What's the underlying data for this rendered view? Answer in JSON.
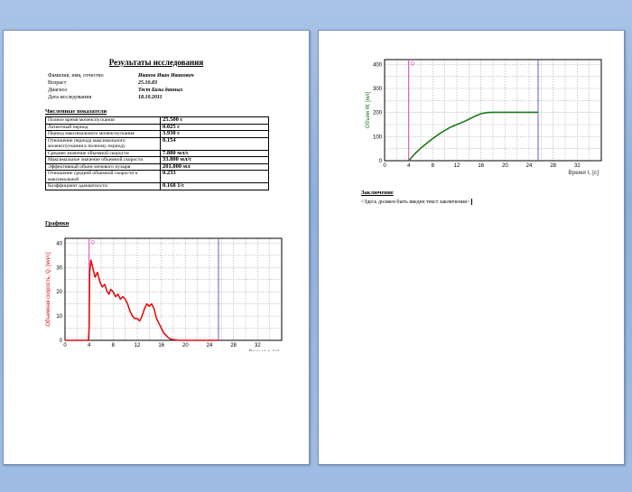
{
  "report": {
    "title": "Результаты исследования",
    "patient": [
      {
        "label": "Фамилия, имя, отчество",
        "value": "Иванов Иван Иванович"
      },
      {
        "label": "Возраст",
        "value": "25.10.83"
      },
      {
        "label": "Диагноз",
        "value": "Тест Базы данных"
      },
      {
        "label": "Дата исследования",
        "value": "18.10.2011"
      }
    ],
    "metrics_heading": "Численные показатели",
    "metrics": [
      {
        "label": "Полное время мочеиспускания",
        "value": "25.500 с"
      },
      {
        "label": "Латентный период",
        "value": "0.025 с"
      },
      {
        "label": "Период максимального мочеиспускания",
        "value": "3.930 с"
      },
      {
        "label": "Отношение периода максимального мочеиспускания к полному периоду",
        "value": "0.154"
      },
      {
        "label": "Среднее значение объемной скорости",
        "value": "7.880 мл/с"
      },
      {
        "label": "Максимальное значение объемной скорости",
        "value": "33.800 мл/с"
      },
      {
        "label": "Эффективный объем мочевого пузыря",
        "value": "201.000 мл"
      },
      {
        "label": "Отношение средней объемной скорости к максимальной",
        "value": "0.233"
      },
      {
        "label": "Коэффициент адекватности",
        "value": "0.168 1/с"
      }
    ],
    "graphs_heading": "Графики",
    "conclusion_heading": "Заключение",
    "conclusion_text": "<Здесь должен быть введен текст заключения>"
  },
  "chart_data": [
    {
      "type": "line",
      "ylabel": "Объемная скорость, Q, [мл/с]",
      "xlabel": "Время t, [с]",
      "xlim": [
        0,
        36
      ],
      "ylim": [
        0,
        42
      ],
      "xticks": [
        0,
        4,
        8,
        12,
        16,
        20,
        24,
        28,
        32
      ],
      "yticks": [
        0,
        10,
        20,
        30,
        40
      ],
      "grid": true,
      "marker_label": "Q",
      "color": "#e01010",
      "markers": [
        {
          "x": 4,
          "color": "#e040c0"
        },
        {
          "x": 25.5,
          "color": "#6a5acd"
        }
      ],
      "series": [
        {
          "x": [
            0,
            3.9,
            4.0,
            4.1,
            4.3,
            4.6,
            5.0,
            5.4,
            5.8,
            6.2,
            6.6,
            7.0,
            7.3,
            7.6,
            8.0,
            8.4,
            8.8,
            9.2,
            9.6,
            10.0,
            10.4,
            10.8,
            11.2,
            11.6,
            12.0,
            12.4,
            12.8,
            13.2,
            13.6,
            14.0,
            14.4,
            14.8,
            15.2,
            15.6,
            16.0,
            16.4,
            16.8,
            17.2,
            17.6,
            18.0,
            18.5,
            19.0,
            25.5
          ],
          "y": [
            0,
            0,
            5,
            28,
            33,
            30,
            26,
            28,
            24,
            22,
            23,
            20,
            19,
            21,
            20,
            18,
            19,
            17,
            18,
            17,
            15,
            12,
            10,
            9,
            9,
            8,
            10,
            13,
            15,
            14,
            15,
            13,
            9,
            7,
            5,
            3,
            2,
            1,
            0.5,
            0.3,
            0.2,
            0,
            0
          ]
        }
      ]
    },
    {
      "type": "line",
      "ylabel": "Объем W, [мл]",
      "xlabel": "Время t, [с]",
      "xlim": [
        0,
        36
      ],
      "ylim": [
        0,
        420
      ],
      "xticks": [
        0,
        4,
        8,
        12,
        16,
        20,
        24,
        28,
        32
      ],
      "yticks": [
        0,
        100,
        200,
        300,
        400
      ],
      "grid": true,
      "marker_label": "Q",
      "color": "#1a7a1a",
      "markers": [
        {
          "x": 4,
          "color": "#e040c0"
        },
        {
          "x": 25.5,
          "color": "#6a5acd"
        }
      ],
      "series": [
        {
          "x": [
            4,
            5,
            6,
            7,
            8,
            9,
            10,
            11,
            12,
            13,
            14,
            15,
            16,
            17,
            18,
            19,
            20,
            22,
            24,
            25.5
          ],
          "y": [
            0,
            28,
            52,
            72,
            92,
            110,
            126,
            140,
            150,
            160,
            172,
            185,
            195,
            200,
            201,
            201,
            201,
            201,
            201,
            201
          ]
        }
      ]
    }
  ]
}
